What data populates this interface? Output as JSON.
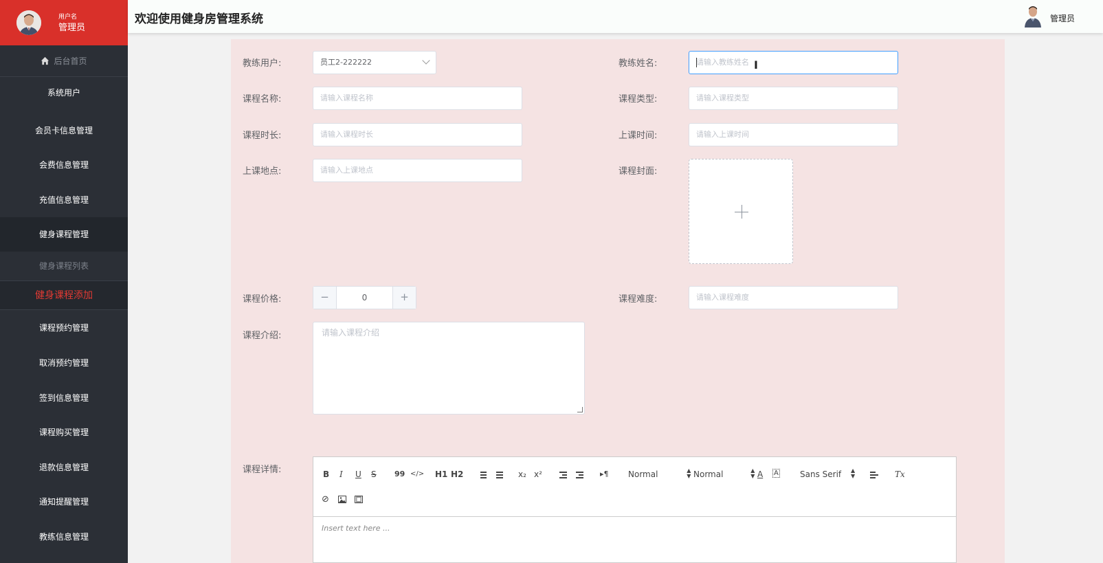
{
  "sidebar": {
    "user_label": "用户名",
    "user_name": "管理员",
    "home": "后台首页",
    "items": [
      "系统用户",
      "会员卡信息管理",
      "会费信息管理",
      "充值信息管理",
      "健身课程管理",
      "健身课程列表",
      "健身课程添加",
      "课程预约管理",
      "取消预约管理",
      "签到信息管理",
      "课程购买管理",
      "退款信息管理",
      "通知提醒管理",
      "教练信息管理"
    ]
  },
  "header": {
    "title": "欢迎使用健身房管理系统",
    "user": "管理员"
  },
  "form": {
    "coach_user_label": "教练用户:",
    "coach_user_value": "员工2-222222",
    "coach_name_label": "教练姓名:",
    "coach_name_placeholder": "请输入教练姓名",
    "course_name_label": "课程名称:",
    "course_name_placeholder": "请输入课程名称",
    "course_type_label": "课程类型:",
    "course_type_placeholder": "请输入课程类型",
    "duration_label": "课程时长:",
    "duration_placeholder": "请输入课程时长",
    "class_time_label": "上课时间:",
    "class_time_placeholder": "请输入上课时间",
    "location_label": "上课地点:",
    "location_placeholder": "请输入上课地点",
    "cover_label": "课程封面:",
    "price_label": "课程价格:",
    "price_value": "0",
    "difficulty_label": "课程难度:",
    "difficulty_placeholder": "请输入课程难度",
    "intro_label": "课程介绍:",
    "intro_placeholder": "请输入课程介绍",
    "detail_label": "课程详情:"
  },
  "editor": {
    "placeholder": "Insert text here ...",
    "header_select": "Normal",
    "size_select": "Normal",
    "font_select": "Sans Serif",
    "btn_bold": "B",
    "btn_italic": "I",
    "btn_underline": "U",
    "btn_strike": "S",
    "btn_quote": "99",
    "btn_code": "</>",
    "btn_h1": "H1",
    "btn_h2": "H2",
    "btn_sub": "x₂",
    "btn_sup": "x²",
    "btn_direction": "▸¶",
    "btn_color": "A",
    "btn_clean": "Tx"
  },
  "colors": {
    "sidebar_bg": "#2b2f36",
    "brand_red": "#d9302a",
    "panel_bg": "#f5e3e3",
    "focus_blue": "#409eff"
  }
}
